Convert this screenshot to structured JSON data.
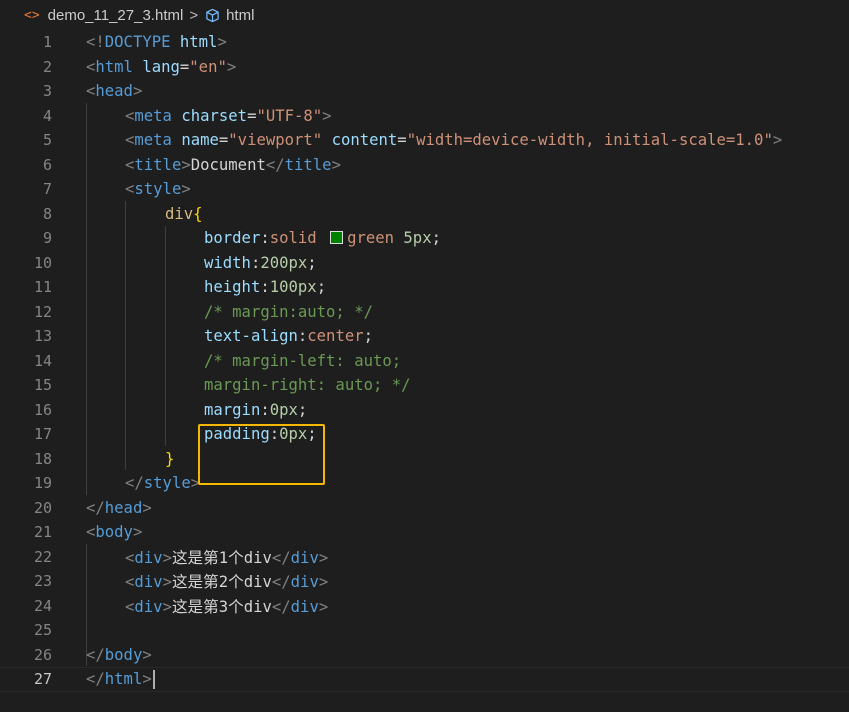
{
  "breadcrumb": {
    "file_icon": "<>",
    "file_name": "demo_11_27_3.html",
    "separator": ">",
    "symbol_icon": "cube-icon",
    "symbol_name": "html"
  },
  "editor": {
    "current_line": 27,
    "line_numbers": [
      "1",
      "2",
      "3",
      "4",
      "5",
      "6",
      "7",
      "8",
      "9",
      "10",
      "11",
      "12",
      "13",
      "14",
      "15",
      "16",
      "17",
      "18",
      "19",
      "20",
      "21",
      "22",
      "23",
      "24",
      "25",
      "26",
      "27"
    ],
    "lines": {
      "l1": {
        "lt": "<!",
        "kw": "DOCTYPE",
        "sp": " ",
        "attr": "html",
        "gt": ">"
      },
      "l2": {
        "lt": "<",
        "tag": "html",
        "sp": " ",
        "attr": "lang",
        "eq": "=",
        "str": "\"en\"",
        "gt": ">"
      },
      "l3": {
        "lt": "<",
        "tag": "head",
        "gt": ">"
      },
      "l4": {
        "lt": "<",
        "tag": "meta",
        "sp": " ",
        "attr": "charset",
        "eq": "=",
        "str": "\"UTF-8\"",
        "gt": ">"
      },
      "l5": {
        "lt": "<",
        "tag": "meta",
        "sp": " ",
        "attr1": "name",
        "eq1": "=",
        "str1": "\"viewport\"",
        "sp2": " ",
        "attr2": "content",
        "eq2": "=",
        "str2": "\"width=device-width, initial-scale=1.0\"",
        "gt": ">"
      },
      "l6": {
        "lt": "<",
        "tag": "title",
        "gt": ">",
        "text": "Document",
        "lt2": "</",
        "tag2": "title",
        "gt2": ">"
      },
      "l7": {
        "lt": "<",
        "tag": "style",
        "gt": ">"
      },
      "l8": {
        "sel": "div",
        "brace": "{"
      },
      "l9": {
        "prop": "border",
        "colon": ":",
        "v1": "solid ",
        "swatch_color": "#008000",
        "v2": "green ",
        "num": "5px",
        "semi": ";"
      },
      "l10": {
        "prop": "width",
        "colon": ":",
        "num": "200px",
        "semi": ";"
      },
      "l11": {
        "prop": "height",
        "colon": ":",
        "num": "100px",
        "semi": ";"
      },
      "l12": {
        "comment": "/* margin:auto; */"
      },
      "l13": {
        "prop": "text-align",
        "colon": ":",
        "val": "center",
        "semi": ";"
      },
      "l14": {
        "comment": "/* margin-left: auto;"
      },
      "l15": {
        "comment": "margin-right: auto; */"
      },
      "l16": {
        "prop": "margin",
        "colon": ":",
        "num": "0px",
        "semi": ";"
      },
      "l17": {
        "prop": "padding",
        "colon": ":",
        "num": "0px",
        "semi": ";"
      },
      "l18": {
        "brace": "}"
      },
      "l19": {
        "lt": "</",
        "tag": "style",
        "gt": ">"
      },
      "l20": {
        "lt": "</",
        "tag": "head",
        "gt": ">"
      },
      "l21": {
        "lt": "<",
        "tag": "body",
        "gt": ">"
      },
      "l22": {
        "lt": "<",
        "tag": "div",
        "gt": ">",
        "text": "这是第1个div",
        "lt2": "</",
        "tag2": "div",
        "gt2": ">"
      },
      "l23": {
        "lt": "<",
        "tag": "div",
        "gt": ">",
        "text": "这是第2个div",
        "lt2": "</",
        "tag2": "div",
        "gt2": ">"
      },
      "l24": {
        "lt": "<",
        "tag": "div",
        "gt": ">",
        "text": "这是第3个div",
        "lt2": "</",
        "tag2": "div",
        "gt2": ">"
      },
      "l26": {
        "lt": "</",
        "tag": "body",
        "gt": ">"
      },
      "l27": {
        "lt": "</",
        "tag": "html",
        "gt": ">"
      }
    }
  },
  "colors": {
    "background": "#1e1e1e",
    "tag": "#569cd6",
    "attribute": "#9cdcfe",
    "string": "#ce9178",
    "number": "#b5cea8",
    "comment": "#6a9955",
    "selector": "#d7ba7d",
    "brace": "#ffd700",
    "highlight_box": "#f5b800"
  }
}
